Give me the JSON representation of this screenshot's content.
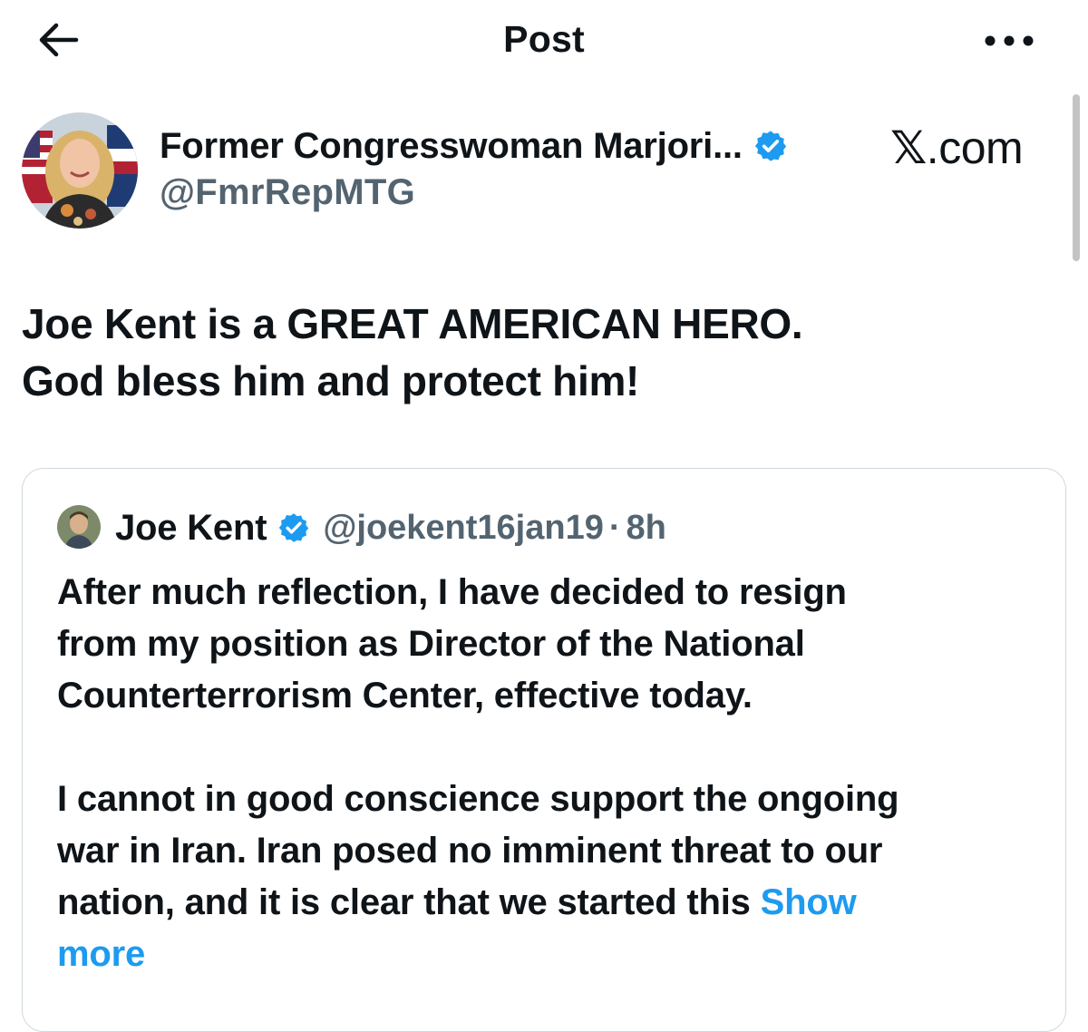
{
  "header": {
    "title": "Post",
    "back_icon": "arrow-left-icon",
    "more_icon": "more-horizontal-icon"
  },
  "post": {
    "author": {
      "display_name": "Former Congresswoman Marjori...",
      "handle": "@FmrRepMTG",
      "verified_icon": "verified-badge-icon"
    },
    "watermark": {
      "x_glyph": "𝕏",
      "suffix": ".com"
    },
    "text_lines": [
      "Joe Kent is a GREAT AMERICAN HERO.",
      "God bless him and protect him!"
    ]
  },
  "quote": {
    "author": {
      "display_name": "Joe Kent",
      "handle": "@joekent16jan19",
      "separator": "·",
      "time": "8h",
      "verified_icon": "verified-badge-icon"
    },
    "text_lines": [
      "After much reflection, I have decided to resign",
      "from my position as Director of the National",
      "Counterterrorism Center, effective today.",
      "",
      "I cannot in good conscience support the ongoing",
      "war in Iran. Iran posed no imminent threat to our",
      "nation, and it is clear that we started this "
    ],
    "show_more_part1": "Show",
    "show_more_part2": "more"
  },
  "colors": {
    "text": "#0f1419",
    "secondary": "#536471",
    "link": "#1d9bf0",
    "verified": "#1d9bf0",
    "border": "#cfd9de"
  }
}
